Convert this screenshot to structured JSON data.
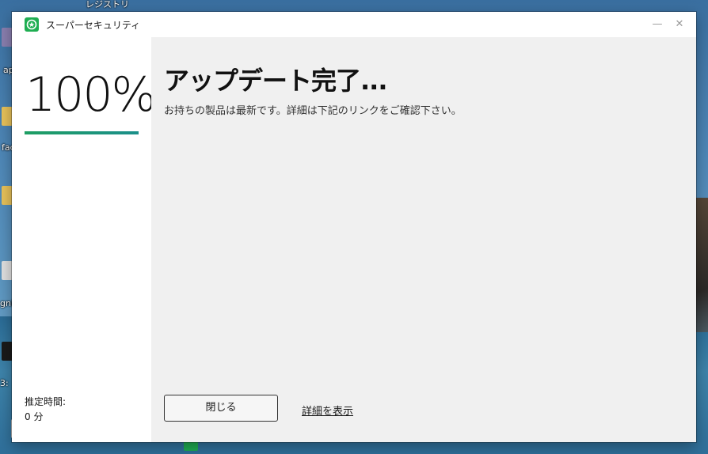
{
  "desktop": {
    "top_label": "レジストリ",
    "side_labels": [
      "ap",
      "fac",
      "gni",
      "3:"
    ]
  },
  "window": {
    "title": "スーパーセキュリティ",
    "minimize_symbol": "—",
    "close_symbol": "✕",
    "logo_icon": "star-shield-icon",
    "accent_color": "#1fae52"
  },
  "progress": {
    "percent_text": "100%",
    "value": 1.0,
    "eta_label": "推定時間:",
    "eta_value": "0 分"
  },
  "main": {
    "heading": "アップデート完了...",
    "message": "お持ちの製品は最新です。詳細は下記のリンクをご確認下さい。",
    "close_label": "閉じる",
    "details_label": "詳細を表示"
  }
}
